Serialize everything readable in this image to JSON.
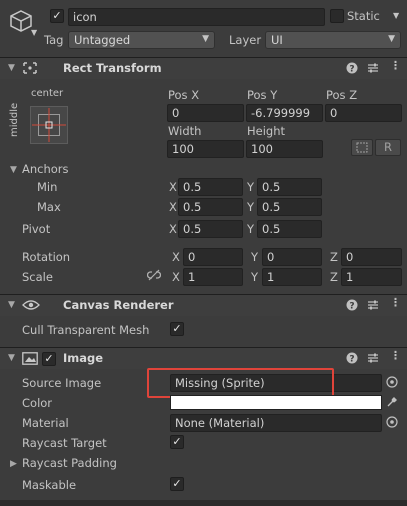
{
  "header": {
    "object_name": "icon",
    "static_label": "Static",
    "tag_label": "Tag",
    "tag_value": "Untagged",
    "layer_label": "Layer",
    "layer_value": "UI"
  },
  "rect_transform": {
    "title": "Rect Transform",
    "anchor_h": "center",
    "anchor_v": "middle",
    "pos_x_label": "Pos X",
    "pos_y_label": "Pos Y",
    "pos_z_label": "Pos Z",
    "pos_x": "0",
    "pos_y": "-6.799999",
    "pos_z": "0",
    "width_label": "Width",
    "height_label": "Height",
    "width": "100",
    "height": "100",
    "r_button": "R",
    "anchors_label": "Anchors",
    "min_label": "Min",
    "max_label": "Max",
    "pivot_label": "Pivot",
    "min_x": "0.5",
    "min_y": "0.5",
    "max_x": "0.5",
    "max_y": "0.5",
    "pivot_x": "0.5",
    "pivot_y": "0.5",
    "rotation_label": "Rotation",
    "rot_x": "0",
    "rot_y": "0",
    "rot_z": "0",
    "scale_label": "Scale",
    "scale_x": "1",
    "scale_y": "1",
    "scale_z": "1",
    "x": "X",
    "y": "Y",
    "z": "Z"
  },
  "canvas_renderer": {
    "title": "Canvas Renderer",
    "cull_label": "Cull Transparent Mesh",
    "cull_checked": true
  },
  "image": {
    "title": "Image",
    "source_label": "Source Image",
    "source_value": "Missing (Sprite)",
    "color_label": "Color",
    "color_value": "#ffffff",
    "material_label": "Material",
    "material_value": "None (Material)",
    "raycast_target_label": "Raycast Target",
    "raycast_padding_label": "Raycast Padding",
    "maskable_label": "Maskable",
    "highlight_color": "#e0443a"
  }
}
